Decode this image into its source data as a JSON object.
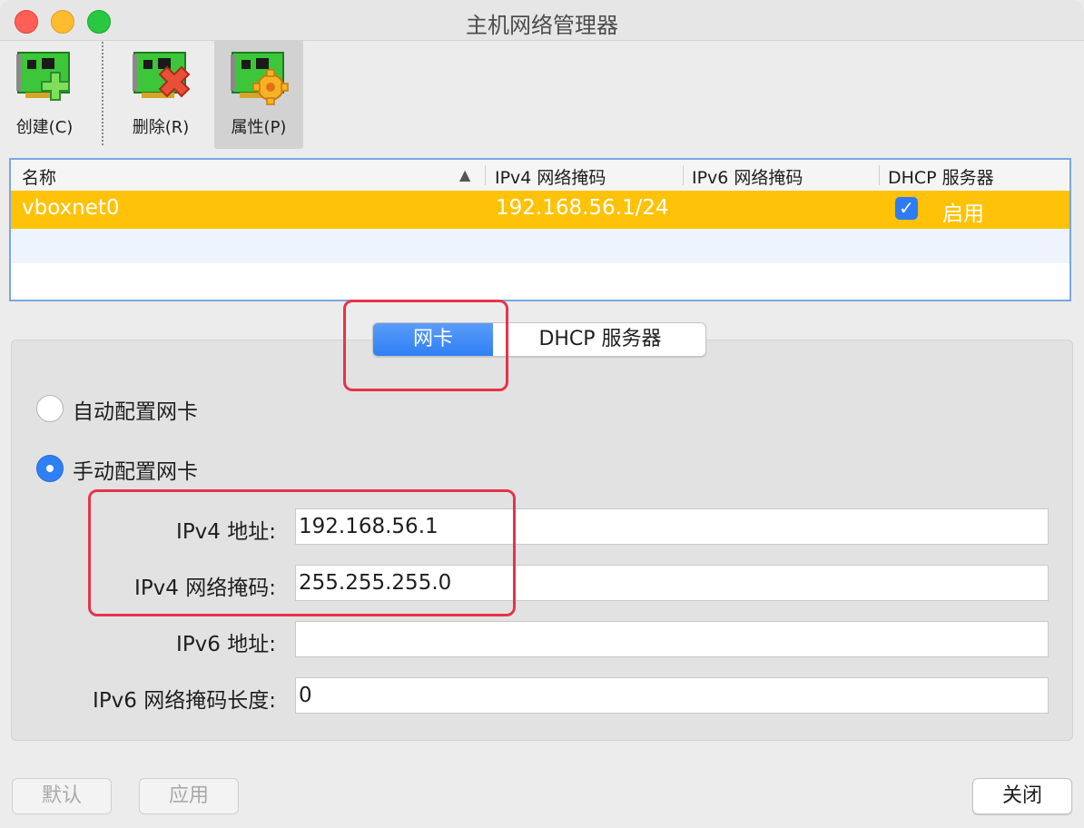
{
  "window": {
    "title": "主机网络管理器"
  },
  "toolbar": {
    "create_label": "创建(C)",
    "delete_label": "删除(R)",
    "properties_label": "属性(P)"
  },
  "table": {
    "columns": [
      "名称",
      "IPv4 网络掩码",
      "IPv6 网络掩码",
      "DHCP 服务器"
    ],
    "rows": [
      {
        "name": "vboxnet0",
        "ipv4_mask": "192.168.56.1/24",
        "ipv6_mask": "",
        "dhcp_checked": true,
        "dhcp_label": "启用"
      }
    ]
  },
  "tabs": {
    "adapter": "网卡",
    "dhcp": "DHCP 服务器"
  },
  "adapter": {
    "auto_label": "自动配置网卡",
    "manual_label": "手动配置网卡",
    "selected": "manual",
    "ipv4_address_label": "IPv4 地址:",
    "ipv4_address_value": "192.168.56.1",
    "ipv4_mask_label": "IPv4 网络掩码:",
    "ipv4_mask_value": "255.255.255.0",
    "ipv6_address_label": "IPv6 地址:",
    "ipv6_address_value": "",
    "ipv6_prefix_label": "IPv6 网络掩码长度:",
    "ipv6_prefix_value": "0"
  },
  "buttons": {
    "default": "默认",
    "apply": "应用",
    "close": "关闭"
  },
  "colors": {
    "selection": "#fec209",
    "accent": "#2f7ff5",
    "highlight": "#e8334b"
  },
  "icons": [
    "network-card-add-icon",
    "network-card-remove-icon",
    "network-card-properties-icon",
    "sort-ascending-icon",
    "checkmark-icon"
  ]
}
